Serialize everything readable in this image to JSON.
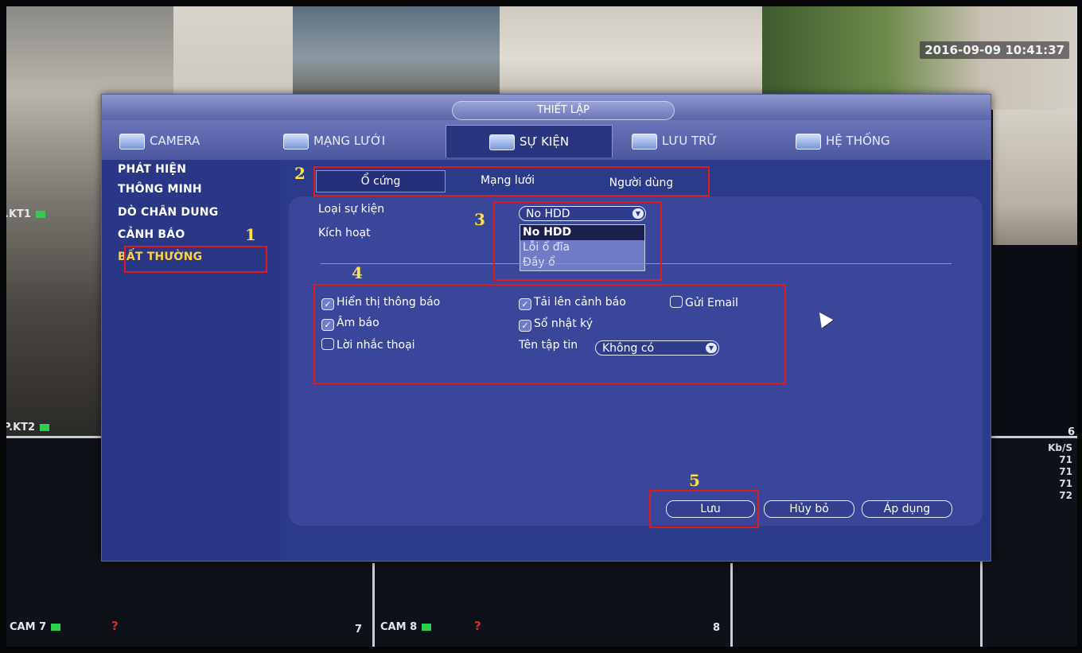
{
  "overlay": {
    "timestamp": "2016-09-09 10:41:37",
    "cam_labels": {
      "kt1": ".KT1",
      "kt2": "P.KT2",
      "cam7": "CAM 7",
      "cam8": "CAM 8"
    },
    "channel_numbers": {
      "six": "6",
      "seven": "7",
      "eight": "8"
    },
    "bitrate": {
      "unit": "Kb/S",
      "values": [
        "71",
        "71",
        "71",
        "72"
      ]
    },
    "no_signal_mark": "?"
  },
  "window": {
    "title": "THIẾT LẬP",
    "tabs": [
      "CAMERA",
      "MẠNG LƯỚI",
      "SỰ KIỆN",
      "LƯU TRỮ",
      "HỆ THỐNG"
    ],
    "active_tab": "SỰ KIỆN"
  },
  "sidebar": {
    "items": [
      "PHÁT HIỆN",
      "THÔNG MINH",
      "DÒ CHÂN DUNG",
      "CẢNH BÁO",
      "BẤT THƯỜNG"
    ],
    "active": "BẤT THƯỜNG"
  },
  "subtabs": {
    "items": [
      "Ổ cứng",
      "Mạng lưới",
      "Người dùng"
    ],
    "active": "Ổ cứng"
  },
  "form": {
    "event_type_label": "Loại sự kiện",
    "enable_label": "Kích hoạt",
    "event_type_value": "No HDD",
    "event_type_options": [
      "No HDD",
      "Lỗi ổ đĩa",
      "Đầy ổ"
    ]
  },
  "checkboxes": {
    "show_message": {
      "label": "Hiển thị thông báo",
      "checked": true
    },
    "upload_alarm": {
      "label": "Tải lên cảnh báo",
      "checked": true
    },
    "send_email": {
      "label": "Gửi Email",
      "checked": false
    },
    "buzzer": {
      "label": "Âm báo",
      "checked": true
    },
    "log": {
      "label": "Sổ nhật ký",
      "checked": true
    },
    "voice_prompt": {
      "label": "Lời nhắc thoại",
      "checked": false
    }
  },
  "file_name": {
    "label": "Tên tập tin",
    "value": "Không có"
  },
  "buttons": {
    "save": "Lưu",
    "cancel": "Hủy bỏ",
    "apply": "Áp dụng"
  },
  "annotations": [
    "1",
    "2",
    "3",
    "4",
    "5"
  ],
  "colors": {
    "panel": "#2c3a8a",
    "highlight": "#ffd23f",
    "annotation_box": "#e11b1b",
    "annotation_number": "#ffe14a"
  }
}
